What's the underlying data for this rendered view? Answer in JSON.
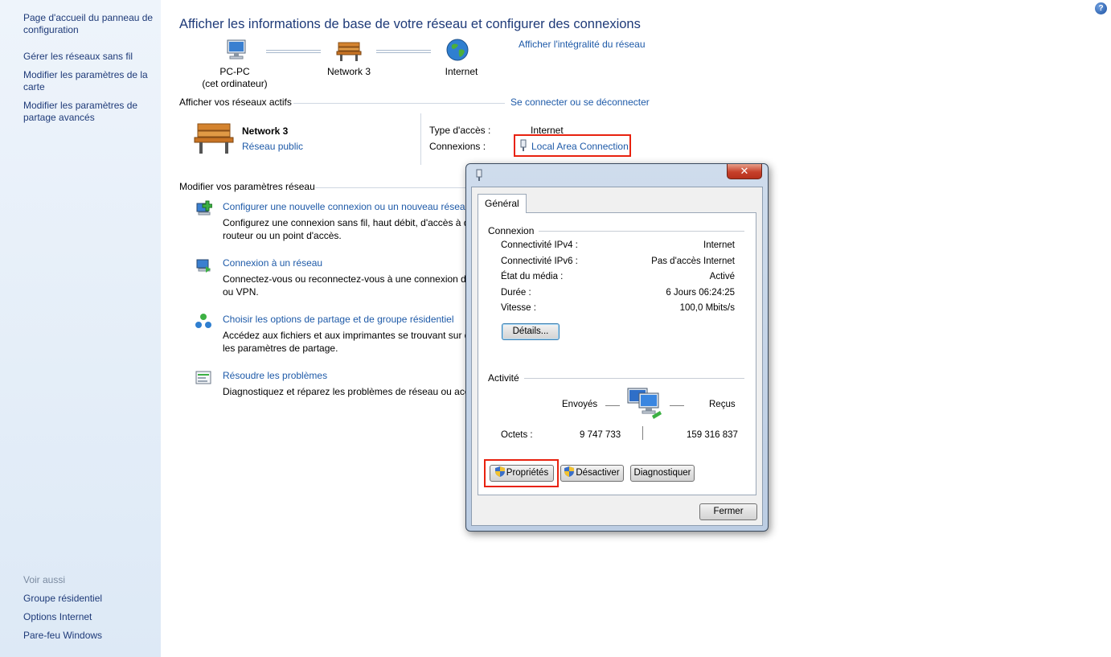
{
  "sidebar": {
    "nav": [
      "Page d'accueil du panneau de configuration",
      "Gérer les réseaux sans fil",
      "Modifier les paramètres de la carte",
      "Modifier les paramètres de partage avancés"
    ],
    "see_also_label": "Voir aussi",
    "see_also": [
      "Groupe résidentiel",
      "Options Internet",
      "Pare-feu Windows"
    ]
  },
  "main": {
    "title": "Afficher les informations de base de votre réseau et configurer des connexions",
    "full_map_link": "Afficher l'intégralité du réseau",
    "map": {
      "computer_name": "PC-PC",
      "computer_sub": "(cet ordinateur)",
      "network_name": "Network  3",
      "internet_label": "Internet"
    },
    "active_networks_label": "Afficher vos réseaux actifs",
    "connect_link": "Se connecter ou se déconnecter",
    "active_network": {
      "name": "Network  3",
      "type_link": "Réseau public",
      "access_type_label": "Type d'accès :",
      "access_type_value": "Internet",
      "connections_label": "Connexions :",
      "connection_link": "Local Area Connection"
    },
    "change_settings_label": "Modifier vos paramètres réseau",
    "tasks": [
      {
        "title": "Configurer une nouvelle connexion ou un nouveau réseau",
        "desc": [
          "Configurez une connexion sans fil, haut débit, d'accès à distance, ad hoc ou VPN ; ou configurez un",
          "routeur ou un point d'accès."
        ]
      },
      {
        "title": "Connexion à un réseau",
        "desc": [
          "Connectez-vous ou reconnectez-vous à une connexion de réseau sans fil, câblé, d'accès à distance",
          "ou VPN."
        ]
      },
      {
        "title": "Choisir les options de partage et de groupe résidentiel",
        "desc": [
          "Accédez aux fichiers et aux imprimantes se trouvant sur d'autres ordinateurs du réseau, ou modifiez",
          "les paramètres de partage."
        ]
      },
      {
        "title": "Résoudre les problèmes",
        "desc": [
          "Diagnostiquez et réparez les problèmes de réseau ou accédez à des informations de dépannage."
        ]
      }
    ]
  },
  "dialog": {
    "close_glyph": "✕",
    "tab_label": "Général",
    "connection_group": "Connexion",
    "rows": [
      {
        "label": "Connectivité IPv4 :",
        "value": "Internet"
      },
      {
        "label": "Connectivité IPv6 :",
        "value": "Pas d'accès Internet"
      },
      {
        "label": "État du média :",
        "value": "Activé"
      },
      {
        "label": "Durée :",
        "value": "6 Jours 06:24:25"
      },
      {
        "label": "Vitesse :",
        "value": "100,0 Mbits/s"
      }
    ],
    "details_button": "Détails...",
    "activity_group": "Activité",
    "sent_label": "Envoyés",
    "received_label": "Reçus",
    "bytes_label": "Octets :",
    "bytes_sent": "9 747 733",
    "bytes_received": "159 316 837",
    "properties_button": "Propriétés",
    "disable_button": "Désactiver",
    "diagnose_button": "Diagnostiquer",
    "close_button": "Fermer"
  },
  "colors": {
    "link": "#1e5aa8",
    "highlight": "#e8220f",
    "sidebar": "#dde9f6"
  }
}
